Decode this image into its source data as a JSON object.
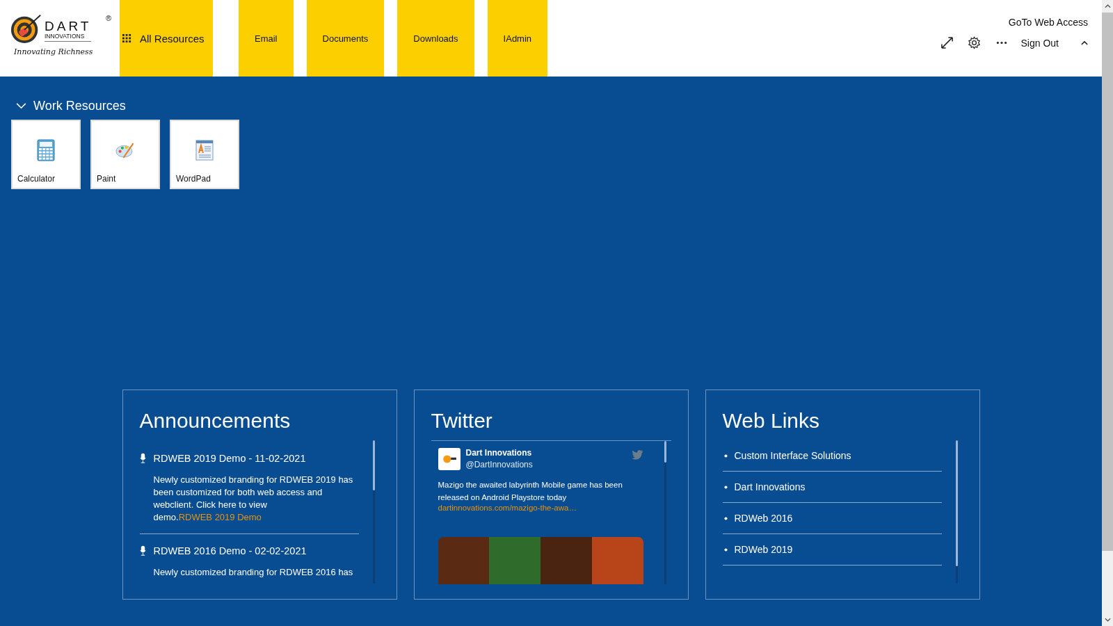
{
  "logo": {
    "name": "DART",
    "sub": "INNOVATIONS",
    "tagline": "Innovating Richness",
    "mark": "®"
  },
  "nav": [
    {
      "label": "All Resources",
      "kind": "grid"
    },
    {
      "label": "Email",
      "kind": "plain"
    },
    {
      "label": "Documents",
      "kind": "plain"
    },
    {
      "label": "Downloads",
      "kind": "plain"
    },
    {
      "label": "IAdmin",
      "kind": "plain"
    }
  ],
  "header_right": {
    "web_access": "GoTo Web Access",
    "sign_out": "Sign Out"
  },
  "section": {
    "title": "Work Resources",
    "expanded": true,
    "apps": [
      {
        "label": "Calculator",
        "kind": "calculator"
      },
      {
        "label": "Paint",
        "kind": "paint"
      },
      {
        "label": "WordPad",
        "kind": "wordpad"
      }
    ]
  },
  "announcements": {
    "title": "Announcements",
    "items": [
      {
        "title": "RDWEB 2019 Demo - 11-02-2021",
        "body": "Newly customized branding for RDWEB 2019 has been customized for both web access and webclient. Click here to view demo.",
        "link": "RDWEB 2019 Demo"
      },
      {
        "title": "RDWEB 2016 Demo - 02-02-2021",
        "body": "Newly customized branding for RDWEB 2016 has"
      }
    ]
  },
  "twitter": {
    "title": "Twitter",
    "tweet": {
      "name": "Dart Innovations",
      "handle": "@DartInnovations",
      "text": "Mazigo the awaited labyrinth Mobile game has been released on Android Playstore today",
      "link": "dartinnovations.com/mazigo-the-awa…"
    }
  },
  "web_links": {
    "title": "Web Links",
    "items": [
      "Custom Interface Solutions",
      "Dart Innovations",
      "RDWeb 2016",
      "RDWeb 2019"
    ]
  }
}
